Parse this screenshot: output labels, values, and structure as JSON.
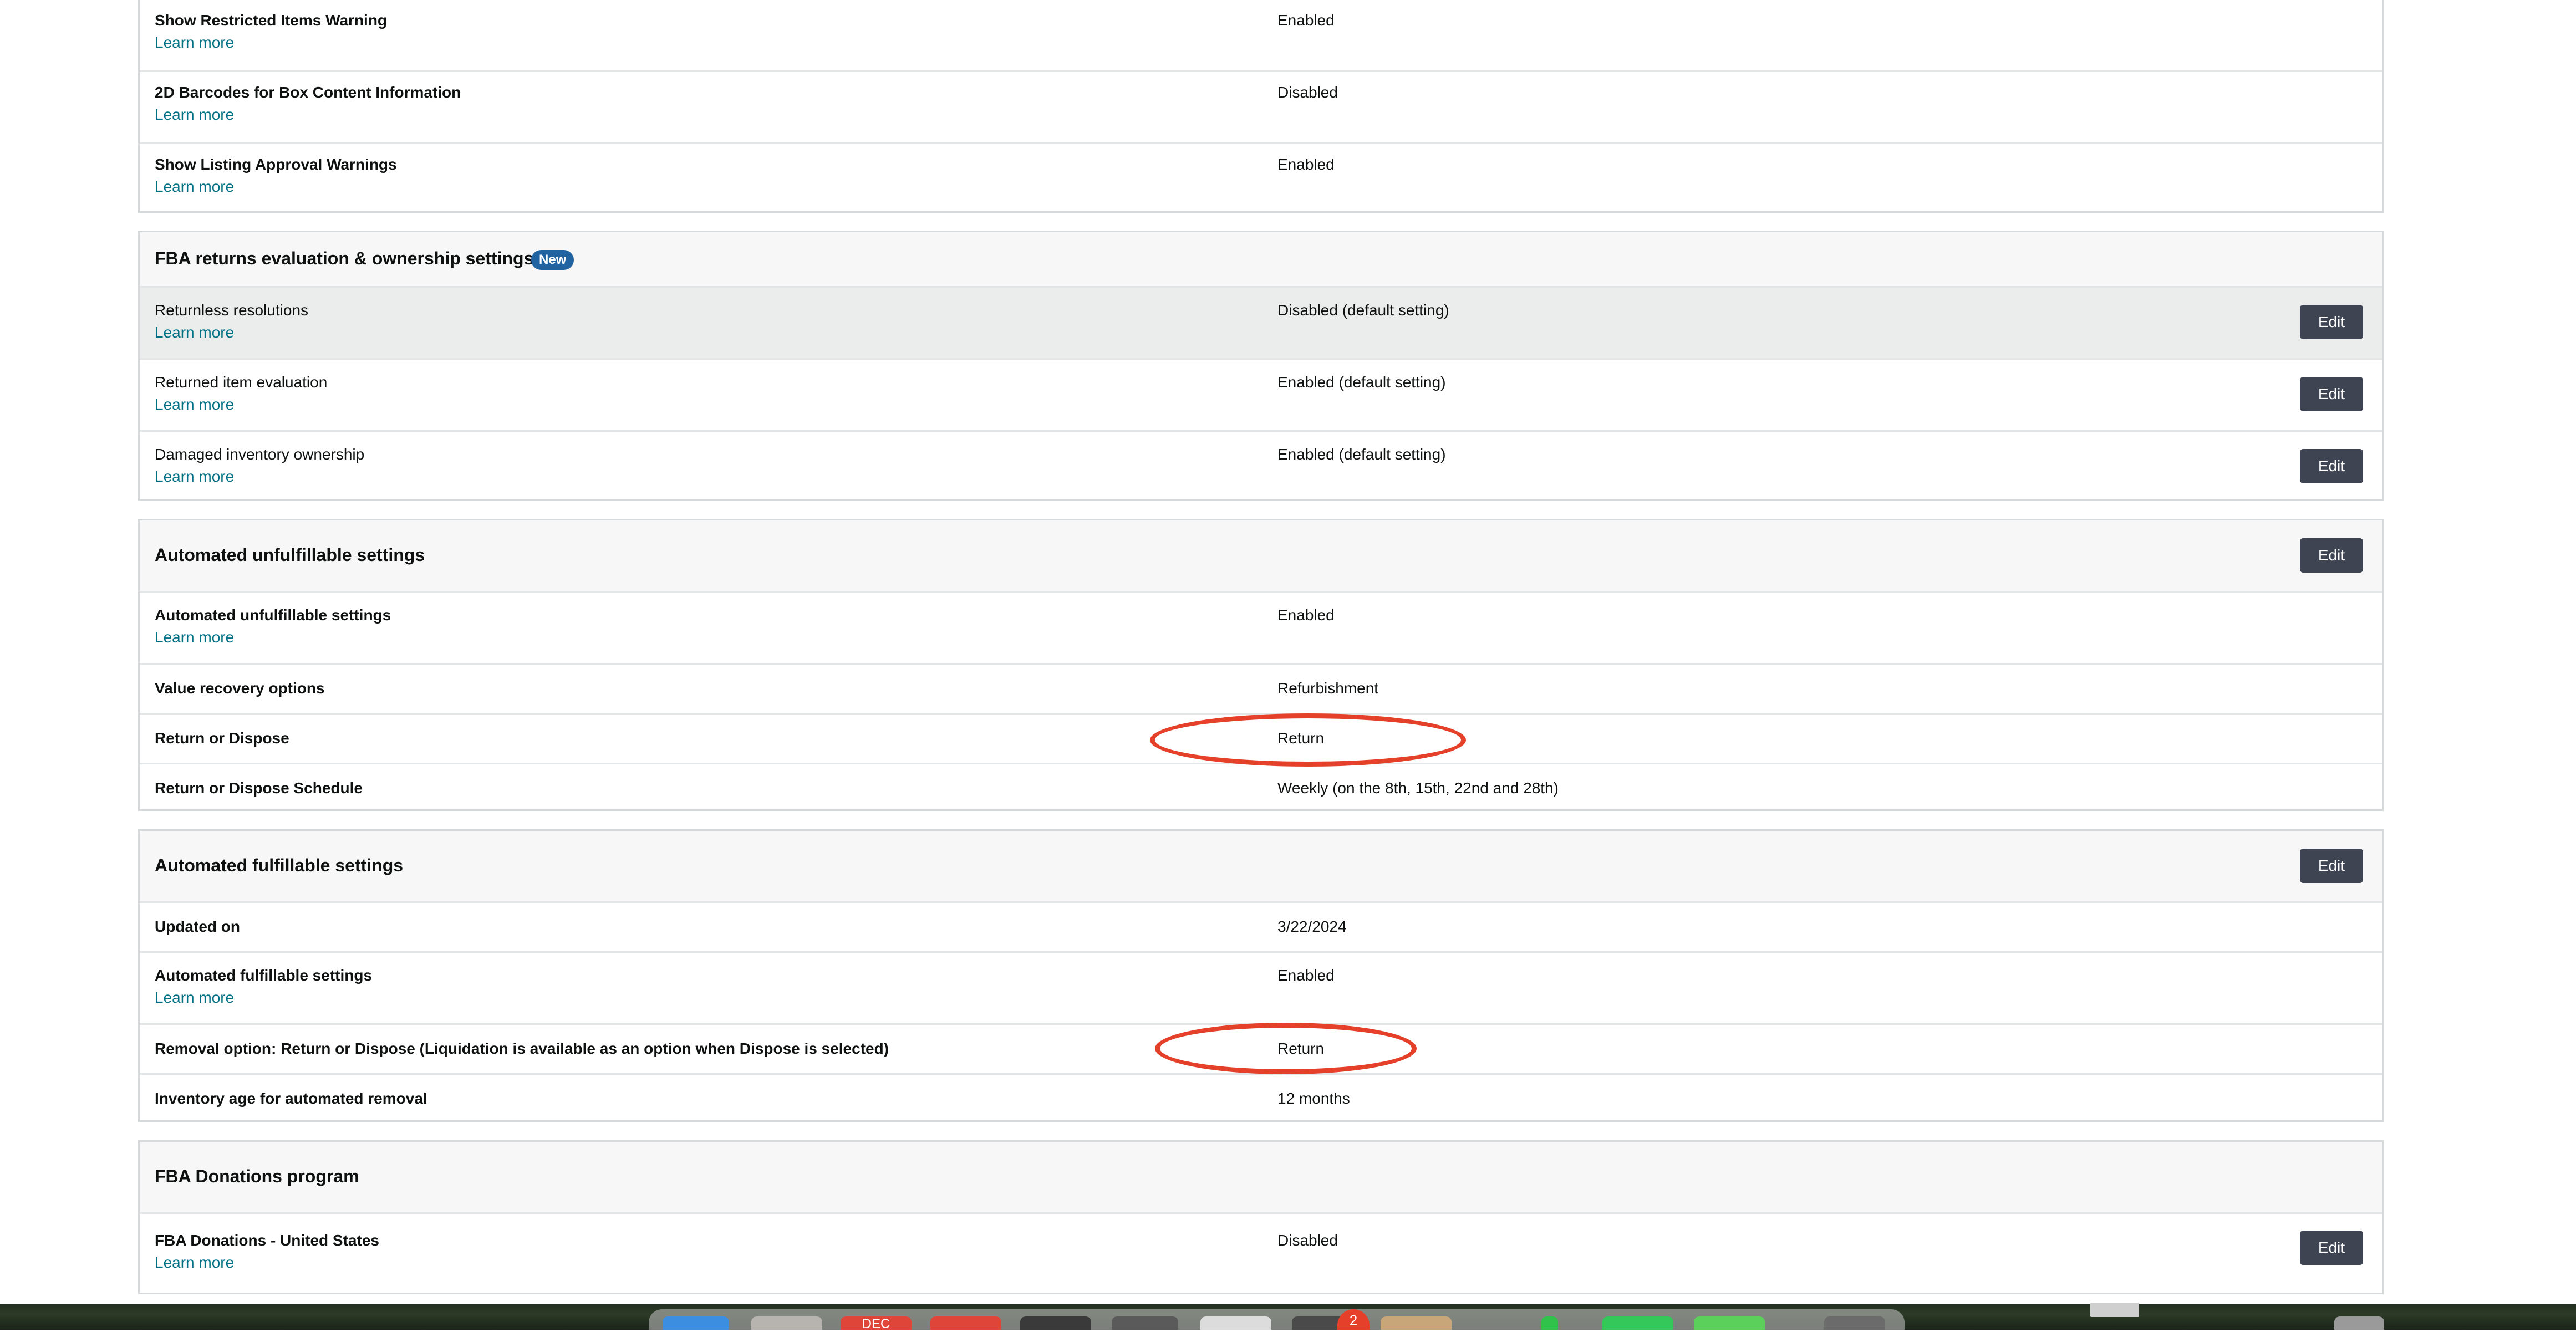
{
  "colors": {
    "link": "#007185",
    "edit_button": "#3e4451",
    "badge": "#2162a1",
    "annotation_circle": "#e4402a"
  },
  "general_settings": [
    {
      "label": "Show Restricted Items Warning",
      "learn_more": "Learn more",
      "value": "Enabled"
    },
    {
      "label": "2D Barcodes for Box Content Information",
      "learn_more": "Learn more",
      "value": "Disabled"
    },
    {
      "label": "Show Listing Approval Warnings",
      "learn_more": "Learn more",
      "value": "Enabled"
    }
  ],
  "returns_section": {
    "title": "FBA returns evaluation & ownership settings",
    "badge": "New",
    "rows": [
      {
        "label": "Returnless resolutions",
        "learn_more": "Learn more",
        "value": "Disabled (default setting)",
        "edit": "Edit"
      },
      {
        "label": "Returned item evaluation",
        "learn_more": "Learn more",
        "value": "Enabled (default setting)",
        "edit": "Edit"
      },
      {
        "label": "Damaged inventory ownership",
        "learn_more": "Learn more",
        "value": "Enabled (default setting)",
        "edit": "Edit"
      }
    ]
  },
  "unfulfillable_section": {
    "title": "Automated unfulfillable settings",
    "edit": "Edit",
    "rows": [
      {
        "label": "Automated unfulfillable settings",
        "learn_more": "Learn more",
        "value": "Enabled"
      },
      {
        "label": "Value recovery options",
        "value": "Refurbishment"
      },
      {
        "label": "Return or Dispose",
        "value": "Return"
      },
      {
        "label": "Return or Dispose Schedule",
        "value": "Weekly (on the 8th, 15th, 22nd and 28th)"
      }
    ]
  },
  "fulfillable_section": {
    "title": "Automated fulfillable settings",
    "edit": "Edit",
    "rows": [
      {
        "label": "Updated on",
        "value": "3/22/2024"
      },
      {
        "label": "Automated fulfillable settings",
        "learn_more": "Learn more",
        "value": "Enabled"
      },
      {
        "label": "Removal option: Return or Dispose (Liquidation is available as an option when Dispose is selected)",
        "value": "Return"
      },
      {
        "label": "Inventory age for automated removal",
        "value": "12 months"
      }
    ]
  },
  "donations_section": {
    "title": "FBA Donations program",
    "rows": [
      {
        "label": "FBA Donations - United States",
        "learn_more": "Learn more",
        "value": "Disabled",
        "edit": "Edit"
      }
    ]
  },
  "dock": {
    "calendar_month": "DEC",
    "notification_count": "2"
  }
}
